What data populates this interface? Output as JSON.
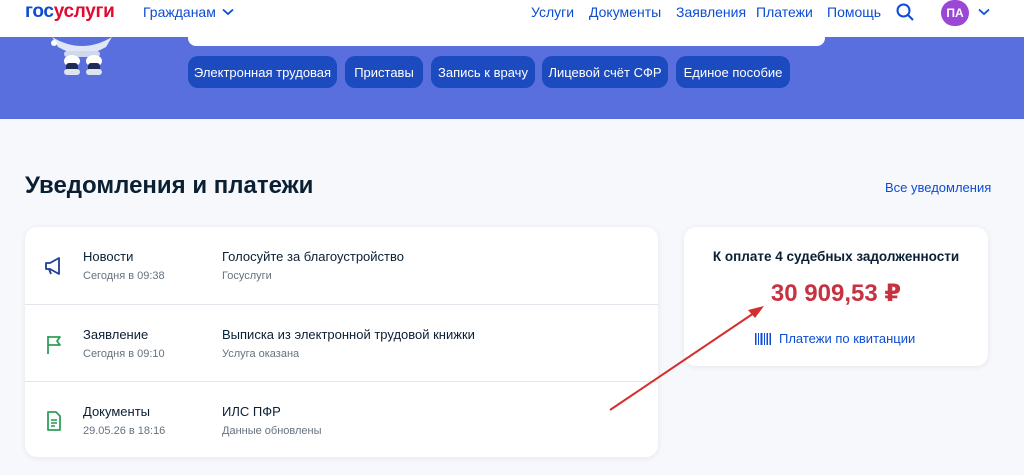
{
  "header": {
    "logo_part1": "гос",
    "logo_part2": "услуги",
    "audience": "Гражданам",
    "nav": [
      "Услуги",
      "Документы",
      "Заявления",
      "Платежи",
      "Помощь"
    ],
    "avatar_initials": "ПА"
  },
  "quick_links": [
    "Электронная трудовая",
    "Приставы",
    "Запись к врачу",
    "Лицевой счёт СФР",
    "Единое пособие"
  ],
  "section": {
    "title": "Уведомления и платежи",
    "all_link": "Все уведомления"
  },
  "notifications": [
    {
      "category": "Новости",
      "time": "Сегодня в 09:38",
      "title": "Голосуйте за благоустройство",
      "subtitle": "Госуслуги",
      "icon": "megaphone-icon"
    },
    {
      "category": "Заявление",
      "time": "Сегодня в 09:10",
      "title": "Выписка из электронной трудовой книжки",
      "subtitle": "Услуга оказана",
      "icon": "flag-icon"
    },
    {
      "category": "Документы",
      "time": "29.05.26 в 18:16",
      "title": "ИЛС ПФР",
      "subtitle": "Данные обновлены",
      "icon": "document-icon"
    }
  ],
  "payment": {
    "title": "К оплате 4 судебных задолженности",
    "amount": "30 909,53 ₽",
    "link": "Платежи по квитанции"
  },
  "colors": {
    "brand_blue": "#0d4cd3",
    "brand_red": "#e3092f",
    "banner": "#5a6fde",
    "chip": "#1c4bbf",
    "amount_red": "#c8313f",
    "annotation_arrow": "#d32f2f"
  }
}
